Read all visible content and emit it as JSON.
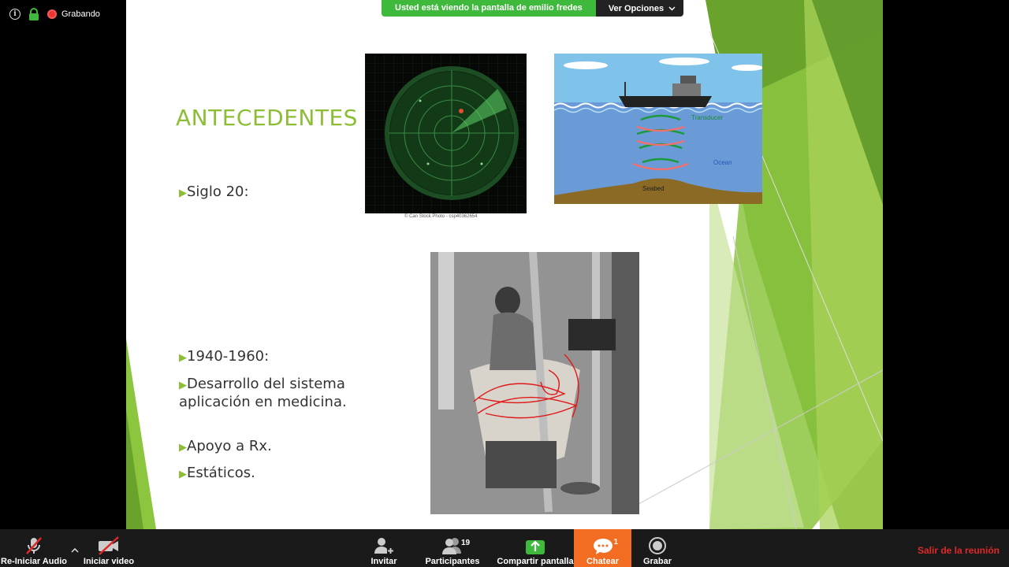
{
  "status": {
    "recording_label": "Grabando"
  },
  "banner": {
    "message": "Usted está viendo la pantalla de emilio fredes",
    "options_label": "Ver Opciones"
  },
  "slide": {
    "title": "ANTECEDENTES",
    "bullets": [
      {
        "text": "Siglo 20:"
      },
      {
        "text": "1940-1960:"
      },
      {
        "text": "Desarrollo del sistema aplicación en medicina."
      },
      {
        "text": "Apoyo a Rx."
      },
      {
        "text": "Estáticos."
      }
    ],
    "radar_caption": "© Can Stock Photo - csp40362654",
    "ship_labels": {
      "transducer": "Transducer",
      "ocean": "Ocean",
      "seabed": "Seabed"
    }
  },
  "toolbar": {
    "audio_label": "Re-Iniciar Audio",
    "video_label": "Iniciar video",
    "invite_label": "Invitar",
    "participants_label": "Participantes",
    "participants_count": "19",
    "share_label": "Compartir pantalla",
    "chat_label": "Chatear",
    "chat_count": "1",
    "record_label": "Grabar",
    "leave_label": "Salir de la reunión"
  },
  "colors": {
    "accent_green": "#8cbe35",
    "zoom_green": "#3fb93b",
    "chat_orange": "#f26d21",
    "leave_red": "#e02828"
  }
}
